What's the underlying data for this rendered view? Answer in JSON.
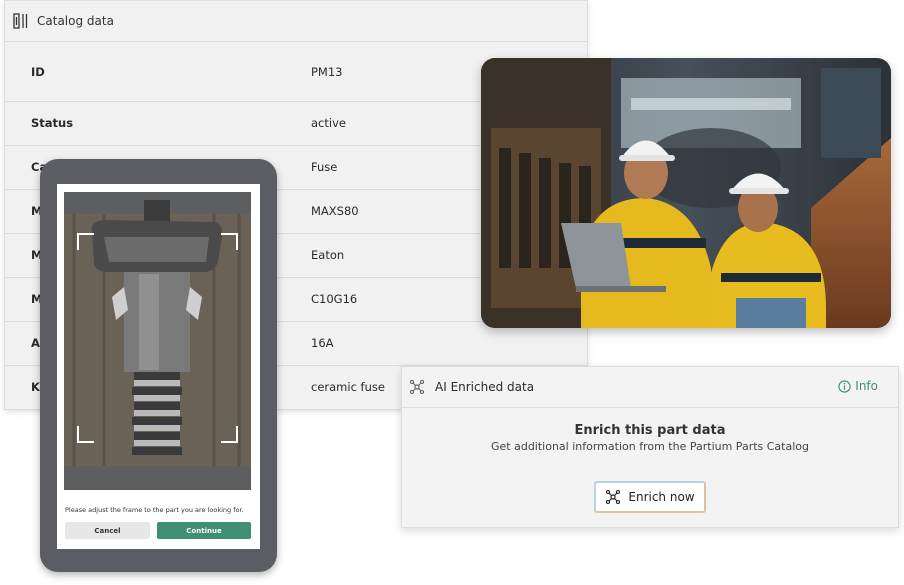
{
  "catalog": {
    "title": "Catalog data",
    "rows": [
      {
        "key": "ID",
        "value": "PM13"
      },
      {
        "key": "Status",
        "value": "active"
      },
      {
        "key": "Ca",
        "value": "Fuse"
      },
      {
        "key": "M",
        "value": "MAXS80"
      },
      {
        "key": "M",
        "value": "Eaton"
      },
      {
        "key": "M",
        "value": "C10G16"
      },
      {
        "key": "A",
        "value": "16A"
      },
      {
        "key": "Ke",
        "value": "ceramic fuse"
      }
    ]
  },
  "photo": {
    "alt": "workers"
  },
  "ai": {
    "title": "AI Enriched data",
    "info_label": "Info",
    "heading": "Enrich this part data",
    "subheading": "Get additional information from the Partium Parts Catalog",
    "button_label": "Enrich now",
    "accent": "#3f8f72"
  },
  "phone": {
    "hint": "Please adjust the frame to the part you are looking for.",
    "cancel_label": "Cancel",
    "continue_label": "Continue"
  }
}
